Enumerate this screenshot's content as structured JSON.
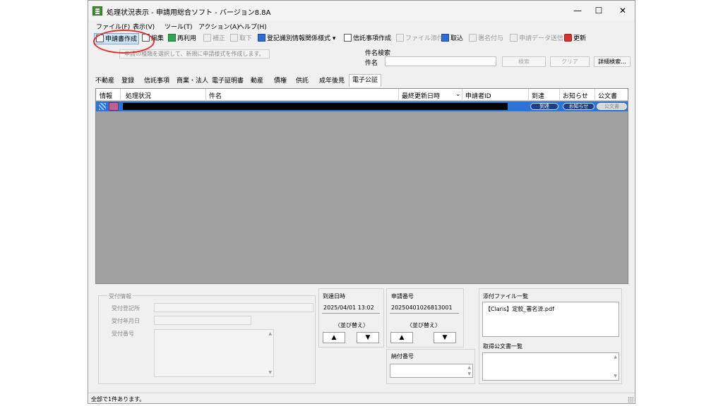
{
  "window": {
    "title": "処理状況表示 - 申請用総合ソフト - バージョン8.8A",
    "minimize": "—",
    "maximize": "☐",
    "close": "✕"
  },
  "menu": [
    "ファイル(F)",
    "表示(V)",
    "ツール(T)",
    "アクション(A)",
    "ヘルプ(H)"
  ],
  "toolbar": {
    "create": "申請書作成",
    "edit": "編集",
    "reuse": "再利用",
    "correct": "補正",
    "withdraw": "取下",
    "registry_format": "登記識別情報関係様式",
    "trust": "信託事項作成",
    "attach": "ファイル添付",
    "import": "取込",
    "sign": "署名付与",
    "send": "申請データ送信",
    "update": "更新"
  },
  "tooltip": "申請の種類を選択して、新規に申請様式を作成します。",
  "search": {
    "title": "件名検索",
    "label": "件名",
    "value": "",
    "search_button": "検索",
    "clear_button": "クリア",
    "detail_button": "詳細検索..."
  },
  "tabs": [
    "不動産",
    "登録",
    "信託事項",
    "商業・法人",
    "電子証明書",
    "動産",
    "債権",
    "供託",
    "成年後見",
    "電子公証"
  ],
  "active_tab": "電子公証",
  "grid": {
    "headers": [
      "情報",
      "処理状況",
      "件名",
      "最終更新日時",
      "申請者ID",
      "到達",
      "お知らせ",
      "公文書"
    ],
    "sort_indicator": "⌄",
    "row": {
      "arrival_button": "到達",
      "notice_button": "お知らせ",
      "official_button": "公文書"
    }
  },
  "reception": {
    "title": "受付情報",
    "office_label": "受付登記所",
    "date_label": "受付年月日",
    "number_label": "受付番号"
  },
  "arrival": {
    "title": "到達日時",
    "value": "2025/04/01 13:02",
    "sort_label": "〈並び替え〉",
    "up": "▲",
    "down": "▼"
  },
  "application": {
    "title": "申請番号",
    "value": "20250401026813001",
    "sort_label": "〈並び替え〉",
    "up": "▲",
    "down": "▼"
  },
  "payment": {
    "title": "納付番号"
  },
  "attachments": {
    "title": "添付ファイル一覧",
    "items": [
      "【Claris】定款_署名済.pdf"
    ]
  },
  "official_docs": {
    "title": "取得公文書一覧"
  },
  "status": "全部で1件あります。",
  "colors": {
    "selection": "#2c74d6",
    "grid_bg": "#a0a0a0",
    "highlight": "#e0302a"
  }
}
